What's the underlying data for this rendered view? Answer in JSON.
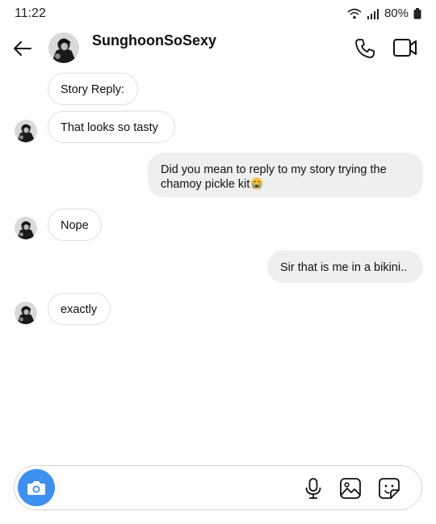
{
  "status_bar": {
    "time": "11:22",
    "battery": "80%"
  },
  "header": {
    "contact_name": "SunghoonSoSexy"
  },
  "messages": [
    {
      "text": "Story Reply:",
      "direction": "incoming"
    },
    {
      "text": "That looks so tasty",
      "direction": "incoming"
    },
    {
      "line1": "Did you mean to reply to my story trying the",
      "line2": "chamoy pickle kit",
      "direction": "outgoing"
    },
    {
      "text": "Nope",
      "direction": "incoming"
    },
    {
      "text": "Sir that is me in a bikini..",
      "direction": "outgoing"
    },
    {
      "text": "exactly",
      "direction": "incoming"
    }
  ],
  "composer": {
    "placeholder": ""
  },
  "icons": {
    "back": "arrow-left-icon",
    "call": "phone-icon",
    "video": "video-camera-icon",
    "camera": "camera-icon",
    "mic": "microphone-icon",
    "gallery": "image-icon",
    "sticker": "sticker-icon",
    "emoji": "crying-face-emoji"
  },
  "colors": {
    "accent": "#3d8ff0",
    "incoming_border": "#dedede",
    "outgoing_bg": "#efefef"
  }
}
